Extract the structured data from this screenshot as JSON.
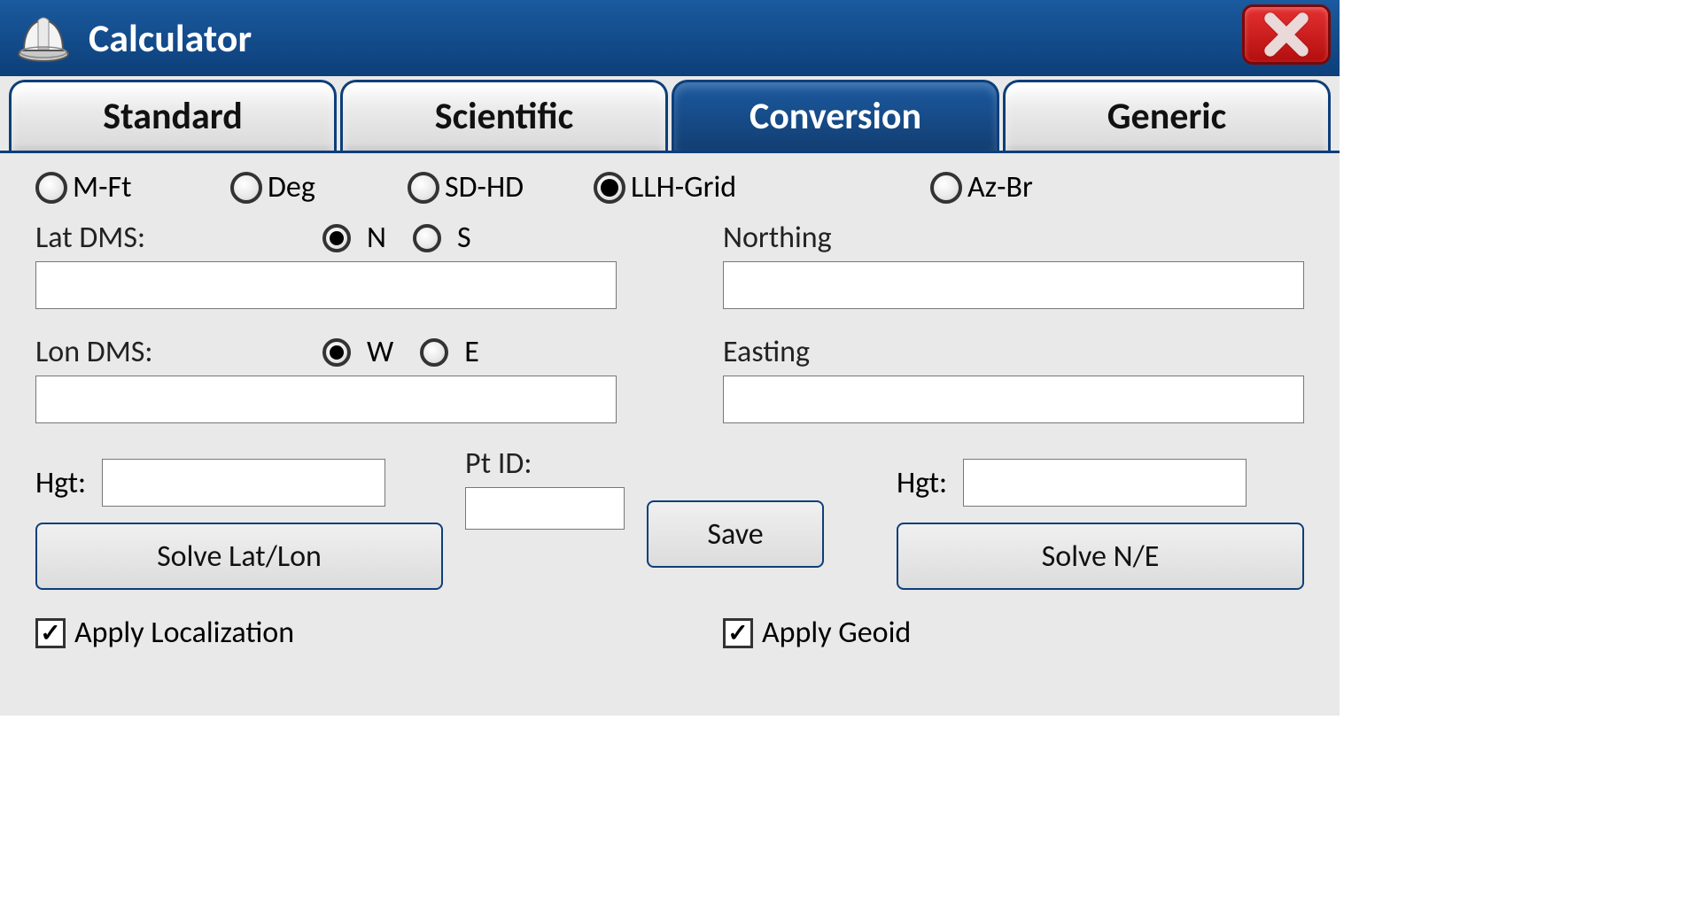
{
  "window": {
    "title": "Calculator"
  },
  "tabs": [
    {
      "label": "Standard",
      "active": false
    },
    {
      "label": "Scientific",
      "active": false
    },
    {
      "label": "Conversion",
      "active": true
    },
    {
      "label": "Generic",
      "active": false
    }
  ],
  "modes": {
    "mft": "M-Ft",
    "deg": "Deg",
    "sdhd": "SD-HD",
    "llh": "LLH-Grid",
    "azbr": "Az-Br",
    "selected": "llh"
  },
  "left": {
    "lat_label": "Lat DMS:",
    "lat_ns": {
      "n": "N",
      "s": "S",
      "selected": "N"
    },
    "lat_value": "",
    "lon_label": "Lon DMS:",
    "lon_we": {
      "w": "W",
      "e": "E",
      "selected": "W"
    },
    "lon_value": "",
    "hgt_label": "Hgt:",
    "hgt_value": "",
    "solve_label": "Solve Lat/Lon"
  },
  "center": {
    "ptid_label": "Pt ID:",
    "ptid_value": "",
    "save_label": "Save"
  },
  "right": {
    "northing_label": "Northing",
    "northing_value": "",
    "easting_label": "Easting",
    "easting_value": "",
    "hgt_label": "Hgt:",
    "hgt_value": "",
    "solve_label": "Solve N/E"
  },
  "checks": {
    "localization": {
      "label": "Apply Localization",
      "checked": true
    },
    "geoid": {
      "label": "Apply Geoid",
      "checked": true
    }
  }
}
